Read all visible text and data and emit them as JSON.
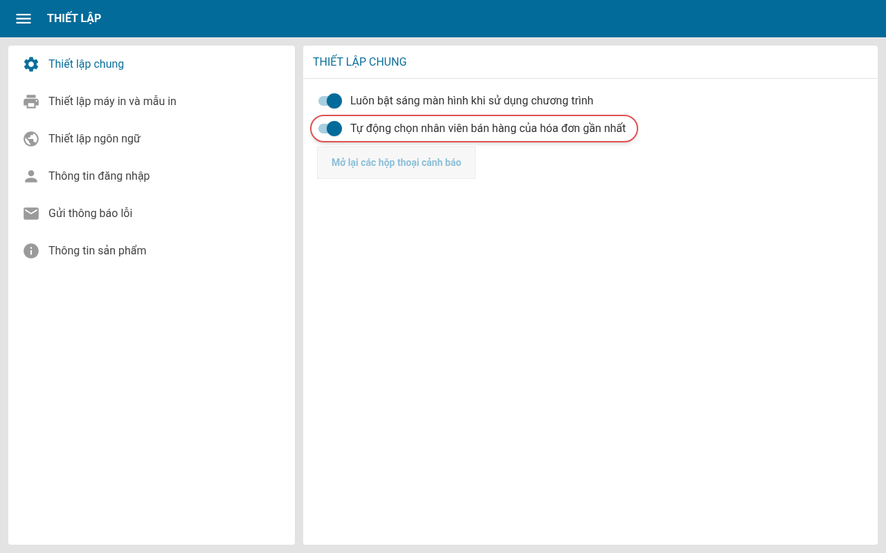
{
  "app_bar": {
    "title": "THIẾT LẬP"
  },
  "sidebar": {
    "items": [
      {
        "label": "Thiết lập chung",
        "kind": "gear",
        "selected": true
      },
      {
        "label": "Thiết lập máy in và mẫu in",
        "kind": "printer",
        "selected": false
      },
      {
        "label": "Thiết lập ngôn ngữ",
        "kind": "globe",
        "selected": false
      },
      {
        "label": "Thông tin đăng nhập",
        "kind": "person",
        "selected": false
      },
      {
        "label": "Gửi thông báo lỗi",
        "kind": "mail",
        "selected": false
      },
      {
        "label": "Thông tin sản phẩm",
        "kind": "info",
        "selected": false
      }
    ]
  },
  "panel": {
    "title": "THIẾT LẬP CHUNG",
    "settings": [
      {
        "label": "Luôn bật sáng màn hình khi sử dụng chương trình",
        "on": true,
        "highlighted": false
      },
      {
        "label": "Tự động chọn nhân viên bán hàng của hóa đơn gần nhất",
        "on": true,
        "highlighted": true
      }
    ],
    "button": {
      "label": "Mở lại các hộp thoại cảnh báo",
      "disabled": true
    }
  }
}
